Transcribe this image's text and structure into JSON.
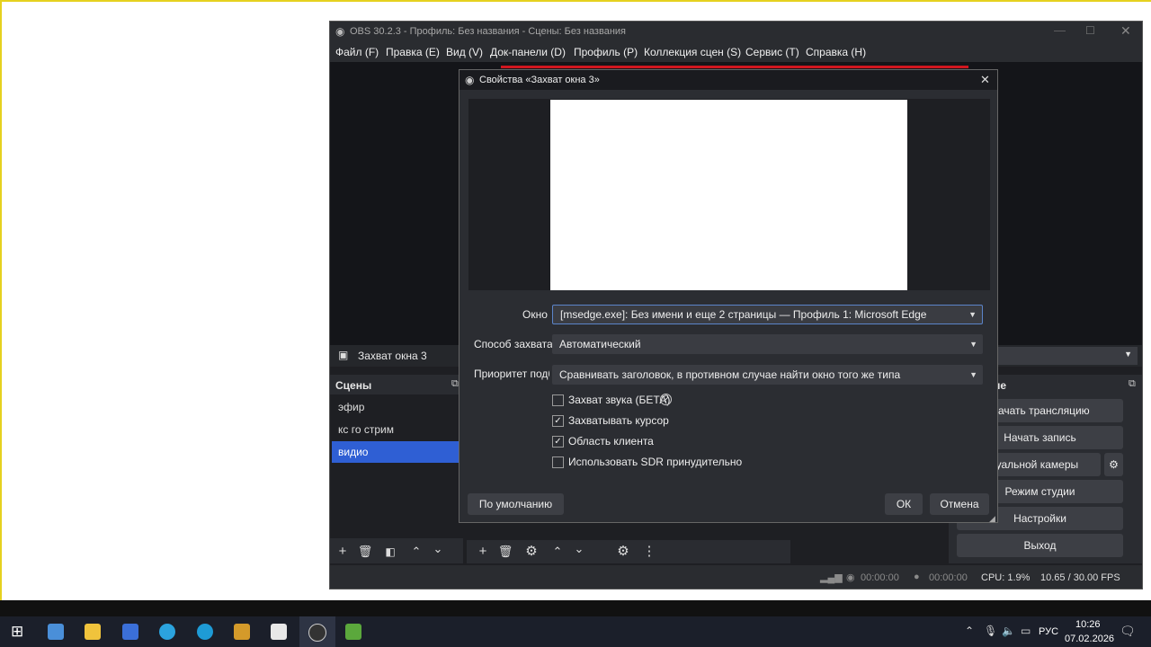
{
  "obs": {
    "window_title": "OBS 30.2.3 - Профиль: Без названия - Сцены: Без названия",
    "menu": [
      "Файл (F)",
      "Правка (E)",
      "Вид (V)",
      "Док-панели (D)",
      "Профиль (P)",
      "Коллекция сцен (S)",
      "Сервис (T)",
      "Справка (H)"
    ],
    "source_bar_label": "Захват окна 3",
    "scenes_header": "Сцены",
    "scenes": [
      "эфир",
      "кс го стрим",
      "видио"
    ],
    "controls_header": "ие",
    "controls": [
      "Начать трансляцию",
      "Начать запись",
      "иртуальной камеры",
      "Режим студии",
      "Настройки",
      "Выход"
    ],
    "status": {
      "stream_time": "00:00:00",
      "rec_time": "00:00:00",
      "cpu": "CPU: 1.9%",
      "fps": "10.65 / 30.00 FPS"
    }
  },
  "dialog": {
    "title": "Свойства «Захват окна 3»",
    "window_label": "Окно",
    "window_value": "[msedge.exe]: Без имени и еще 2 страницы — Профиль 1: Microsoft Edge",
    "capture_label": "Способ захвата",
    "capture_value": "Автоматический",
    "priority_label": "Приоритет подб",
    "priority_value": "Сравнивать заголовок, в противном случае найти окно того же типа",
    "checkboxes": [
      {
        "label": "Захват звука (БЕТА)",
        "checked": false
      },
      {
        "label": "Захватывать курсор",
        "checked": true
      },
      {
        "label": "Область клиента",
        "checked": true
      },
      {
        "label": "Использовать SDR принудительно",
        "checked": false
      }
    ],
    "defaults_button": "По умолчанию",
    "ok_button": "ОК",
    "cancel_button": "Отмена"
  },
  "taskbar": {
    "language": "РУС",
    "time": "10:26",
    "date": "07.02.2026"
  }
}
